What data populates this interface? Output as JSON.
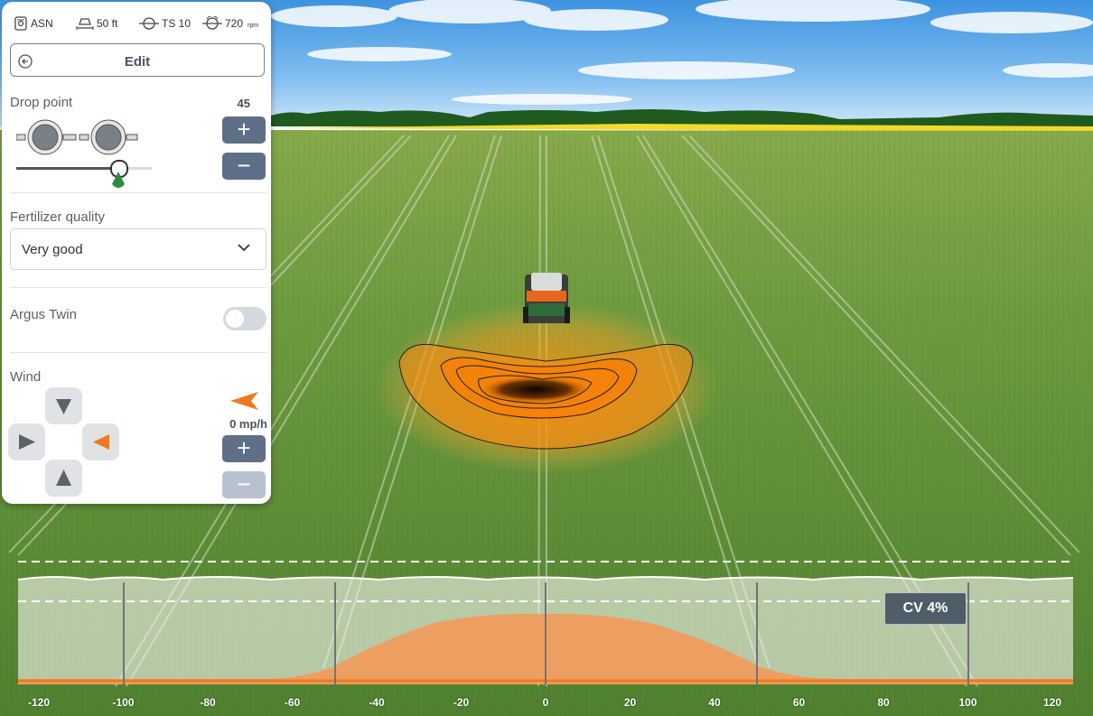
{
  "status_bar": {
    "fertilizer": "ASN",
    "working_width": "50 ft",
    "spreading_disc": "TS 10",
    "disc_speed": "720",
    "disc_speed_unit": "rpm"
  },
  "header": {
    "edit_label": "Edit"
  },
  "drop_point": {
    "label": "Drop point",
    "value": "45",
    "slider_fraction": 0.78
  },
  "fertilizer_quality": {
    "label": "Fertilizer quality",
    "selected": "Very good"
  },
  "argus_twin": {
    "label": "Argus Twin",
    "enabled": false
  },
  "wind": {
    "label": "Wind",
    "speed": "0 mp/h",
    "direction": "left"
  },
  "distribution": {
    "cv_label": "CV 4%",
    "x_ticks": [
      "-120",
      "-100",
      "-80",
      "-60",
      "-40",
      "-20",
      "0",
      "20",
      "40",
      "60",
      "80",
      "100",
      "120"
    ]
  },
  "colors": {
    "accent": "#f07a1b",
    "button": "#5e6f87",
    "button_disabled": "#b8c2cf",
    "slider_thumb": "#2f8b3e"
  },
  "icons": [
    "fertilizer-bag-icon",
    "working-width-icon",
    "spreading-disc-icon",
    "disc-speed-icon",
    "back-arrow-icon",
    "chevron-down-icon",
    "plus-icon",
    "minus-icon",
    "wind-direction-icon",
    "tractor-icon"
  ]
}
